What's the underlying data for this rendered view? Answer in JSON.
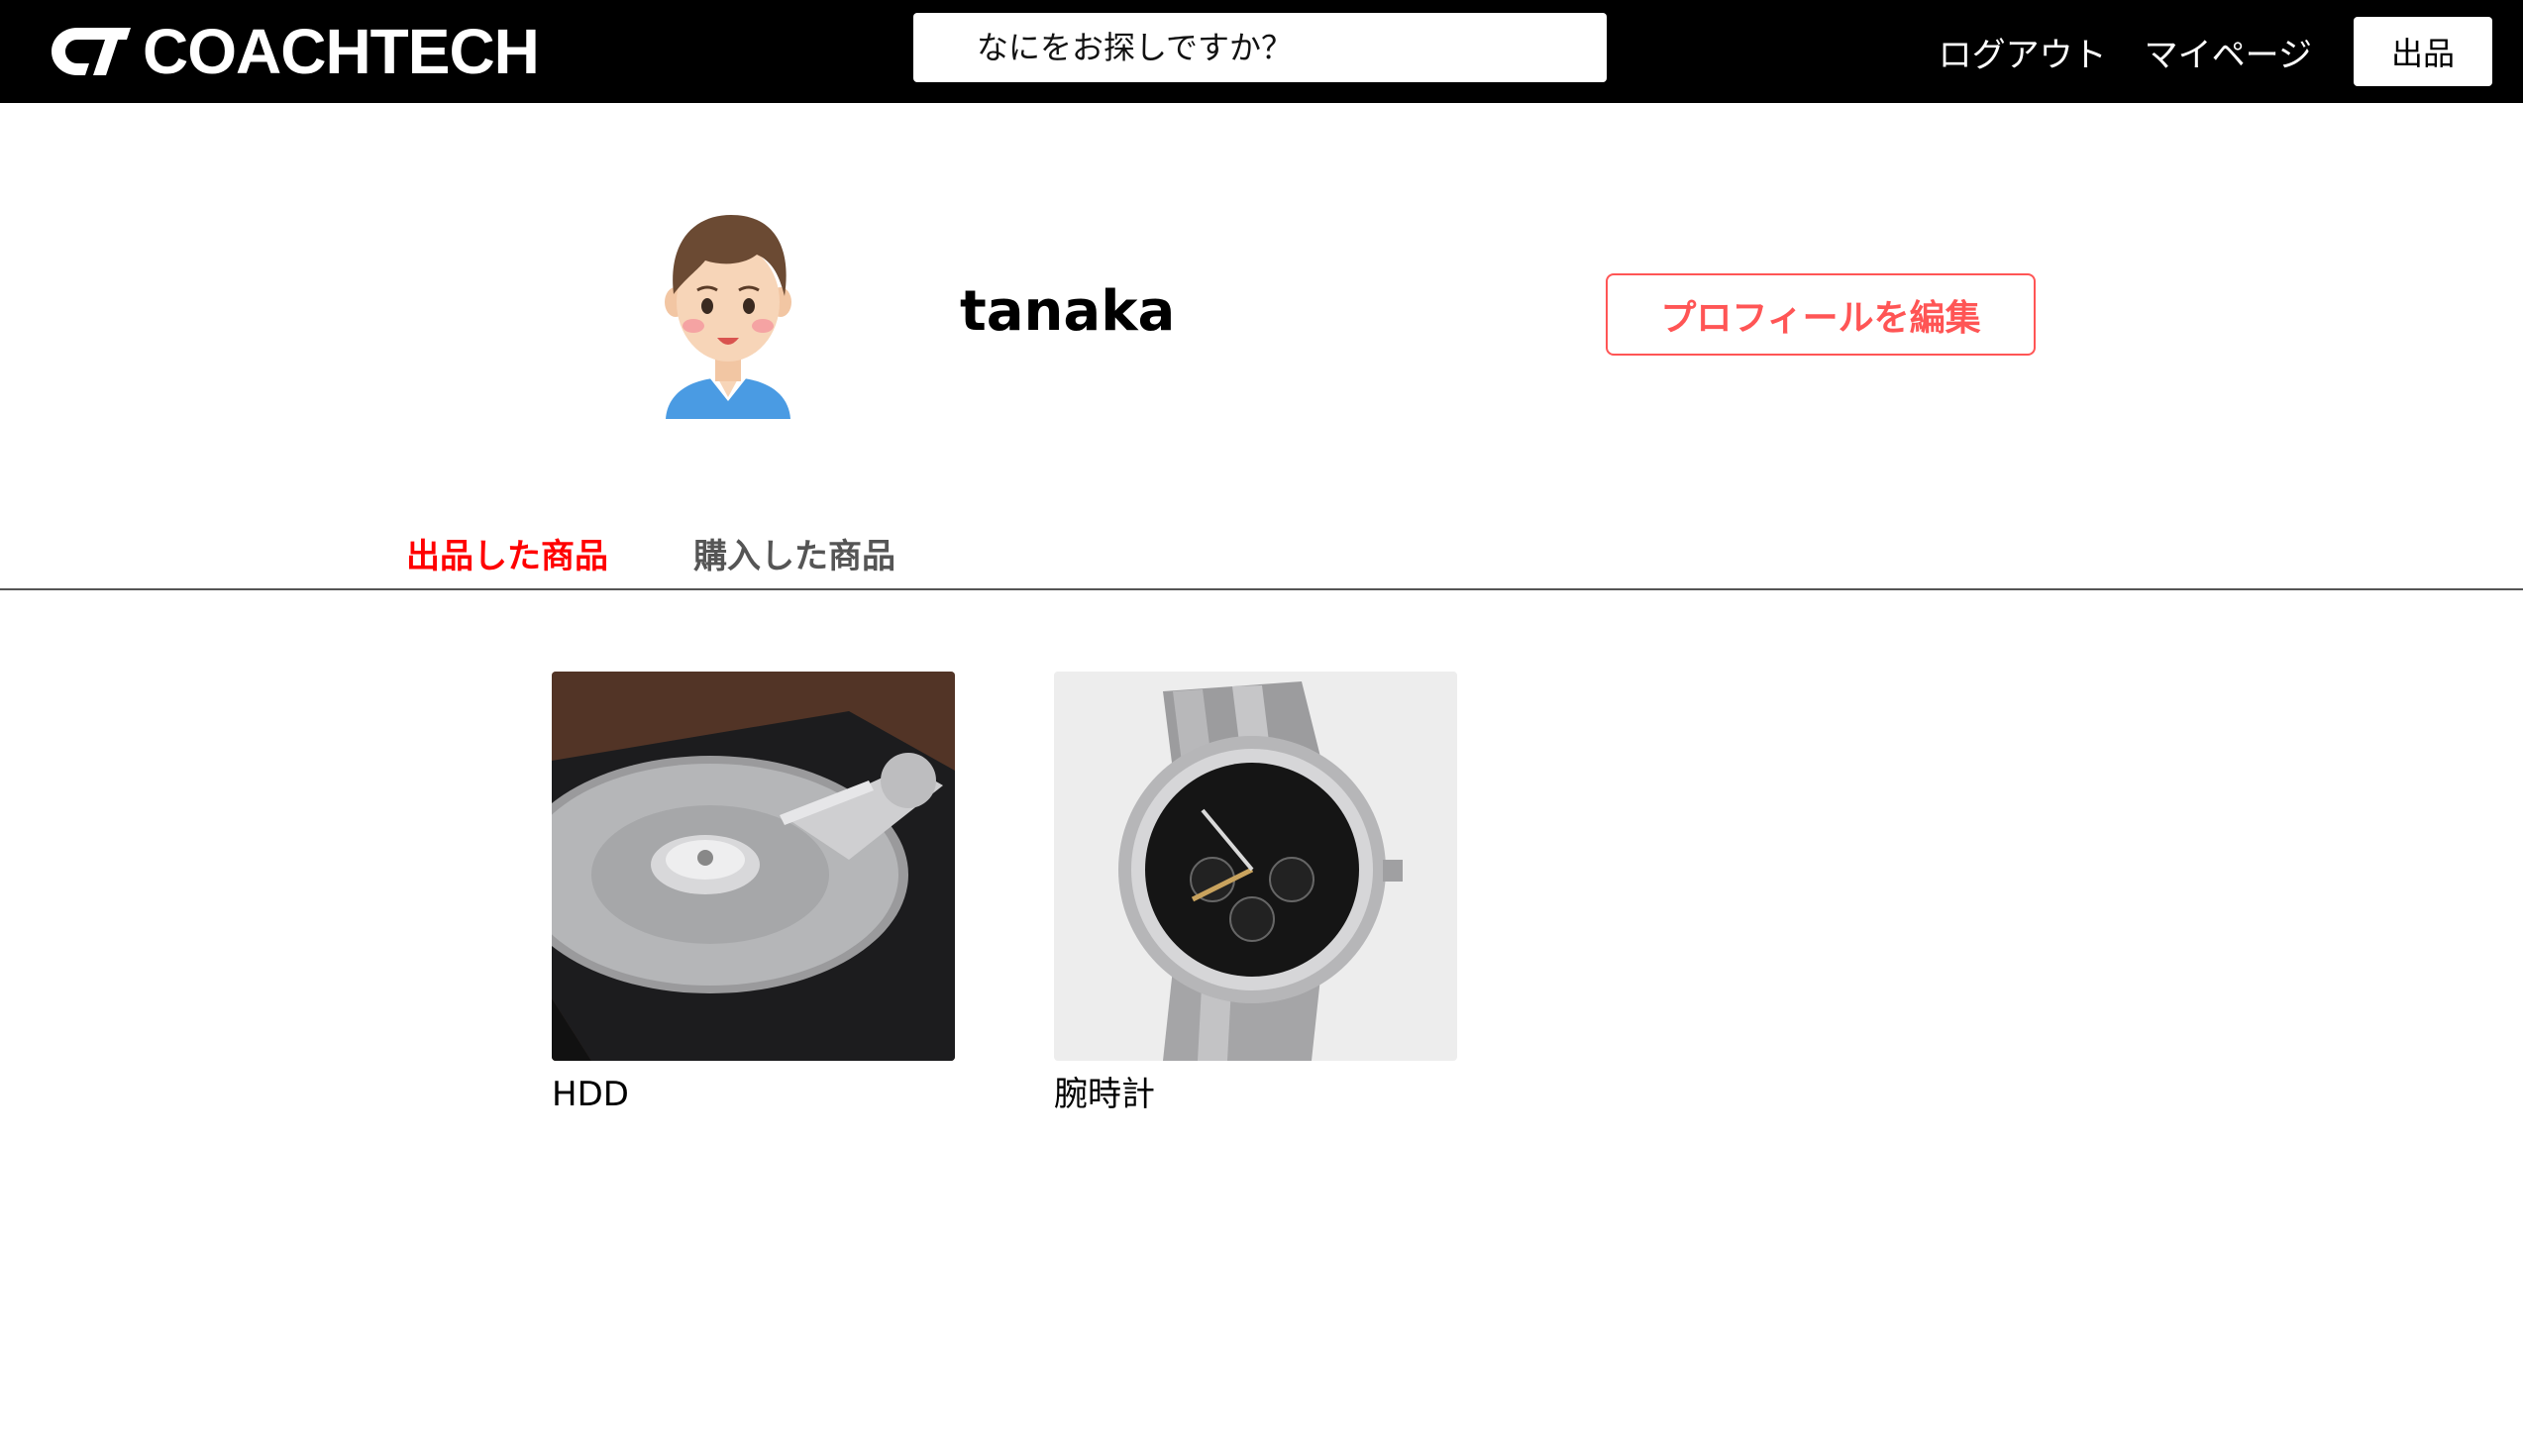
{
  "header": {
    "logo_text": "COACHTECH",
    "search_placeholder": "なにをお探しですか？",
    "nav": {
      "logout_label": "ログアウト",
      "mypage_label": "マイページ",
      "sell_label": "出品"
    }
  },
  "profile": {
    "username": "tanaka",
    "edit_label": "プロフィールを編集"
  },
  "tabs": [
    {
      "label": "出品した商品",
      "active": true
    },
    {
      "label": "購入した商品",
      "active": false
    }
  ],
  "products": [
    {
      "name": "HDD",
      "image": "hard-disk-drive-photo"
    },
    {
      "name": "腕時計",
      "image": "wristwatch-photo"
    }
  ],
  "colors": {
    "header_bg": "#000000",
    "accent": "#ff5555",
    "active_tab": "#ff0000",
    "inactive_tab": "#555555"
  }
}
